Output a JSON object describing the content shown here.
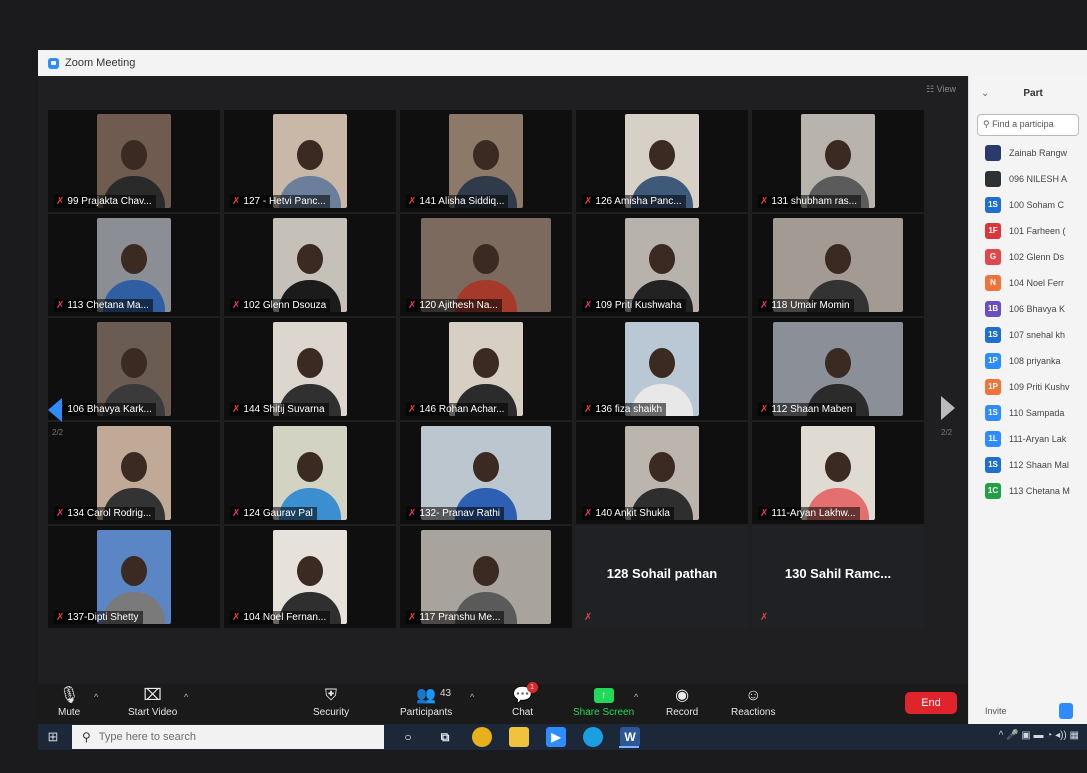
{
  "window": {
    "title": "Zoom Meeting"
  },
  "gallery": {
    "view_label": "View",
    "page_left": "2/2",
    "page_right": "2/2",
    "tiles": [
      "99 Prajakta Chav...",
      "127 - Hetvi Panc...",
      "141 Alisha Siddiq...",
      "126 Amisha Panc...",
      "131 shubham ras...",
      "113 Chetana Ma...",
      "102 Glenn Dsouza",
      "120 Ajithesh Na...",
      "109 Priti Kushwaha",
      "118 Umair Momin",
      "106 Bhavya Kark...",
      "144 Shitij Suvarna",
      "146 Rohan Achar...",
      "136 fiza shaikh",
      "112 Shaan Maben",
      "134 Carol Rodrig...",
      "124 Gaurav Pal",
      "132- Pranav Rathi",
      "140 Ankit Shukla",
      "111-Aryan Lakhw...",
      "137-Dipti Shetty",
      "104 Noel Fernan...",
      "117 Pranshu Me...",
      "128 Sohail pathan",
      "130 Sahil Ramc..."
    ]
  },
  "toolbar": {
    "mute": "Mute",
    "start_video": "Start Video",
    "security": "Security",
    "participants": "Participants",
    "participants_count": "43",
    "chat": "Chat",
    "chat_badge": "1",
    "share_screen": "Share Screen",
    "record": "Record",
    "reactions": "Reactions",
    "end": "End"
  },
  "participants_panel": {
    "title": "Part",
    "search_placeholder": "Find a participa",
    "items": [
      {
        "initials": "",
        "name": "Zainab Rangw",
        "color": "#2a3a6a"
      },
      {
        "initials": "",
        "name": "096 NILESH A",
        "color": "#2c3135"
      },
      {
        "initials": "1S",
        "name": "100 Soham C",
        "color": "#1f6fd0"
      },
      {
        "initials": "1F",
        "name": "101 Farheen (",
        "color": "#d9353a"
      },
      {
        "initials": "G",
        "name": "102 Glenn Ds",
        "color": "#e2474b"
      },
      {
        "initials": "N",
        "name": "104 Noel Ferr",
        "color": "#f0743a"
      },
      {
        "initials": "1B",
        "name": "106 Bhavya K",
        "color": "#6a4fc4"
      },
      {
        "initials": "1S",
        "name": "107 snehal kh",
        "color": "#1f6fd0"
      },
      {
        "initials": "1P",
        "name": "108 priyanka",
        "color": "#2d8cff"
      },
      {
        "initials": "1P",
        "name": "109 Priti Kushv",
        "color": "#f0743a"
      },
      {
        "initials": "1S",
        "name": "110 Sampada",
        "color": "#2d8cff"
      },
      {
        "initials": "1L",
        "name": "111-Aryan Lak",
        "color": "#2d8cff"
      },
      {
        "initials": "1S",
        "name": "112 Shaan Mal",
        "color": "#1f6fd0"
      },
      {
        "initials": "1C",
        "name": "113 Chetana M",
        "color": "#23a047"
      }
    ],
    "invite": "Invite"
  },
  "taskbar": {
    "search_placeholder": "Type here to search"
  }
}
